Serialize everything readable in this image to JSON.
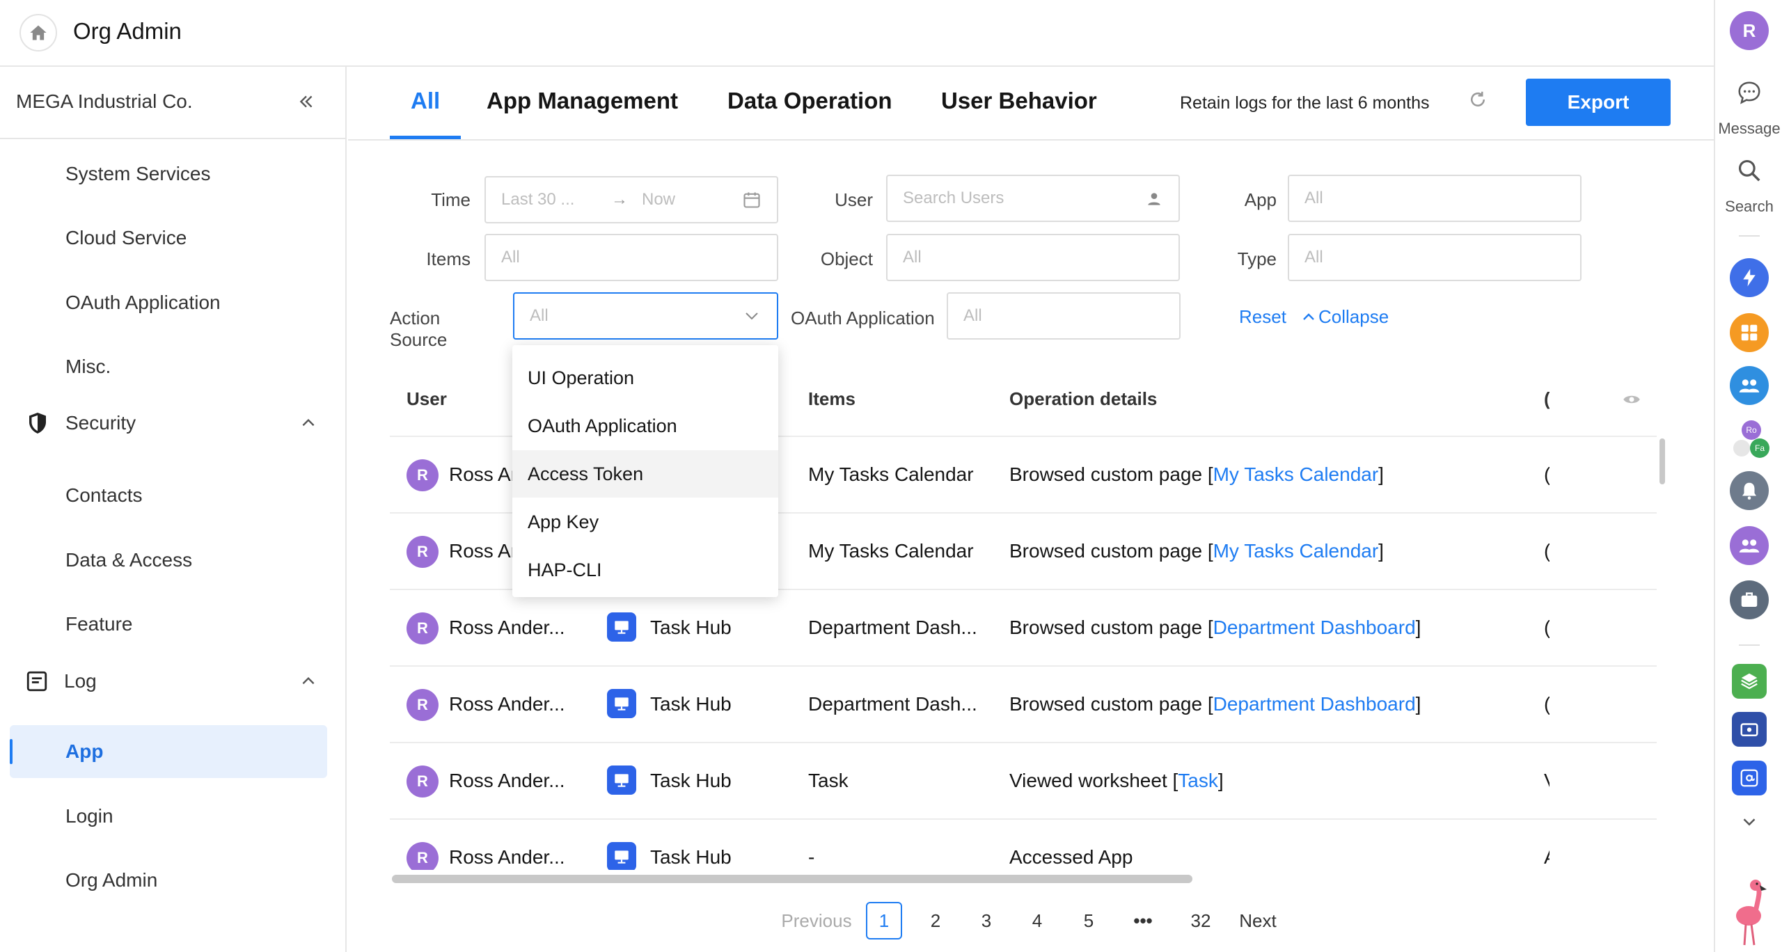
{
  "header": {
    "title": "Org Admin"
  },
  "sidebar": {
    "org_name": "MEGA Industrial Co.",
    "items_top": [
      "System Services",
      "Cloud Service",
      "OAuth Application",
      "Misc."
    ],
    "security": {
      "label": "Security",
      "items": [
        "Contacts",
        "Data & Access",
        "Feature"
      ]
    },
    "log": {
      "label": "Log",
      "items": [
        "App",
        "Login",
        "Org Admin"
      ],
      "active": "App"
    }
  },
  "tabs": [
    "All",
    "App Management",
    "Data Operation",
    "User Behavior"
  ],
  "active_tab": "All",
  "retain_text": "Retain logs for the last 6 months",
  "export_label": "Export",
  "filters": {
    "time_label": "Time",
    "time_start": "Last 30 ...",
    "time_arrow": "→",
    "time_end": "Now",
    "user_label": "User",
    "user_placeholder": "Search Users",
    "app_label": "App",
    "app_value": "All",
    "items_label": "Items",
    "items_value": "All",
    "object_label": "Object",
    "object_value": "All",
    "type_label": "Type",
    "type_value": "All",
    "action_source_label": "Action Source",
    "action_source_value": "All",
    "oauth_label": "OAuth Application",
    "oauth_value": "All",
    "reset_label": "Reset",
    "collapse_label": "Collapse"
  },
  "dropdown": {
    "options": [
      "UI Operation",
      "OAuth Application",
      "Access Token",
      "App Key",
      "HAP-CLI"
    ],
    "hovered": "Access Token"
  },
  "table": {
    "headers": {
      "user": "User",
      "items": "Items",
      "details": "Operation details"
    },
    "rows": [
      {
        "avatar": "R",
        "user": "Ross An",
        "app": "",
        "items": "My Tasks Calendar",
        "detail_prefix": "Browsed custom page [",
        "detail_link": "My Tasks Calendar",
        "detail_suffix": "]",
        "cut": "("
      },
      {
        "avatar": "R",
        "user": "Ross An",
        "app": "",
        "items": "My Tasks Calendar",
        "detail_prefix": "Browsed custom page [",
        "detail_link": "My Tasks Calendar",
        "detail_suffix": "]",
        "cut": "("
      },
      {
        "avatar": "R",
        "user": "Ross Ander...",
        "app": "Task Hub",
        "items": "Department Dash...",
        "detail_prefix": "Browsed custom page [",
        "detail_link": "Department Dashboard",
        "detail_suffix": "]",
        "cut": "("
      },
      {
        "avatar": "R",
        "user": "Ross Ander...",
        "app": "Task Hub",
        "items": "Department Dash...",
        "detail_prefix": "Browsed custom page [",
        "detail_link": "Department Dashboard",
        "detail_suffix": "]",
        "cut": "("
      },
      {
        "avatar": "R",
        "user": "Ross Ander...",
        "app": "Task Hub",
        "items": "Task",
        "detail_prefix": "Viewed worksheet [",
        "detail_link": "Task",
        "detail_suffix": "]",
        "cut": "V"
      },
      {
        "avatar": "R",
        "user": "Ross Ander...",
        "app": "Task Hub",
        "items": "-",
        "detail_prefix": "Accessed App",
        "detail_link": "",
        "detail_suffix": "",
        "cut": "A"
      }
    ]
  },
  "pagination": {
    "previous": "Previous",
    "pages": [
      "1",
      "2",
      "3",
      "4",
      "5"
    ],
    "ellipsis": "•••",
    "last": "32",
    "next": "Next",
    "current": "1"
  },
  "rightrail": {
    "avatar": "R",
    "message_label": "Message",
    "search_label": "Search",
    "mini_avatars": [
      "Ro",
      "Fa"
    ]
  }
}
